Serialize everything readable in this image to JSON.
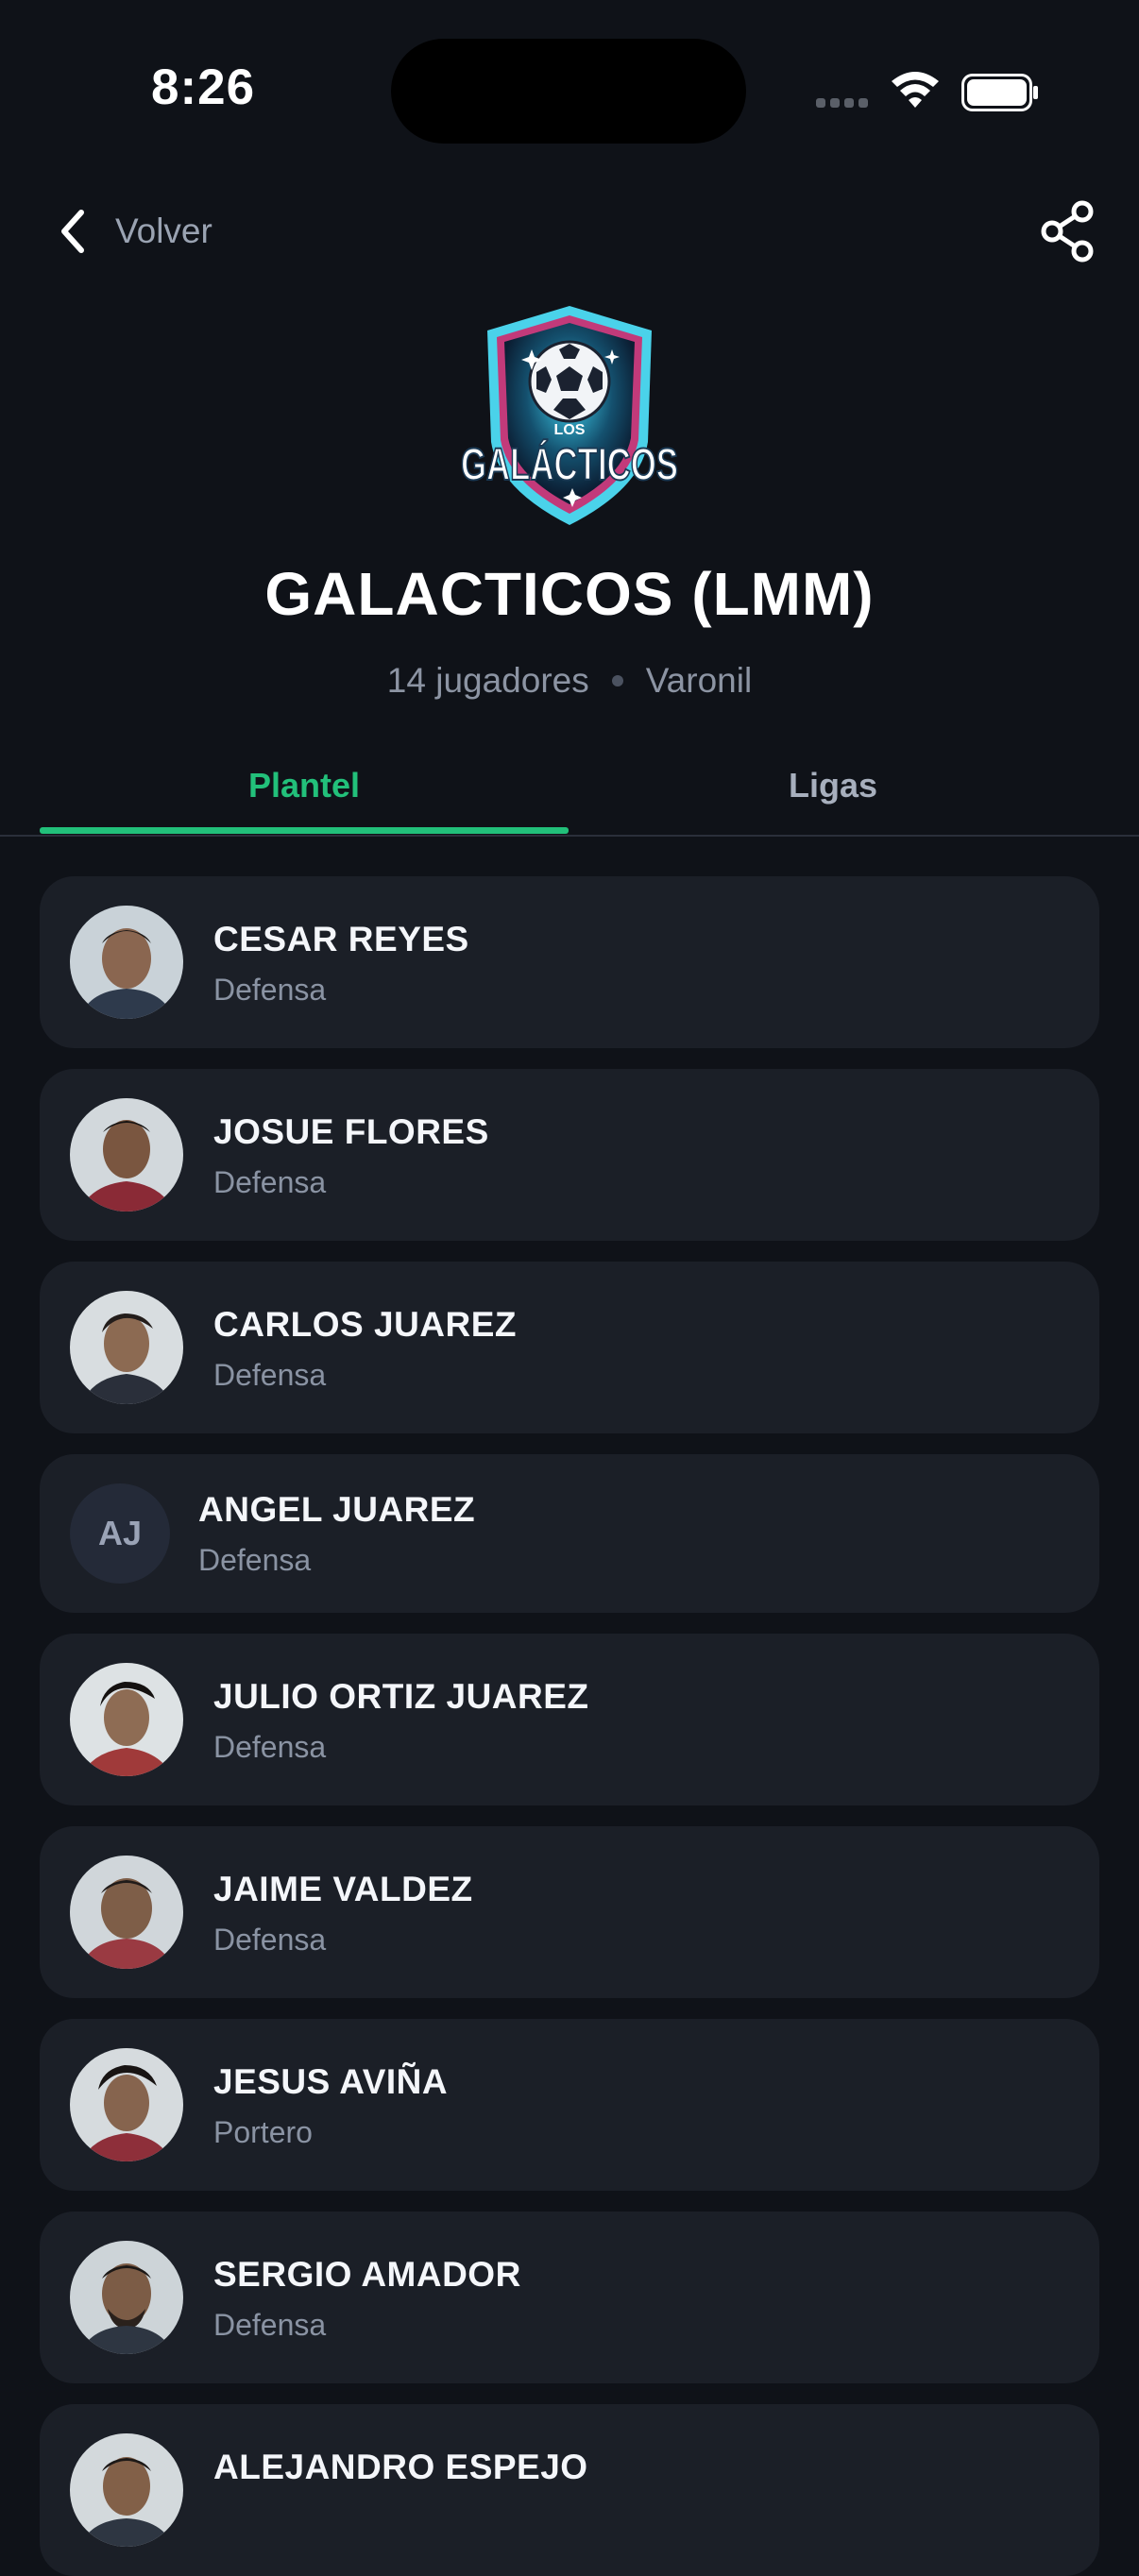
{
  "status_bar": {
    "time": "8:26"
  },
  "nav": {
    "back_label": "Volver",
    "back_icon": "chevron-left-icon",
    "share_icon": "share-icon"
  },
  "team": {
    "crest_top_text": "LOS",
    "crest_main_text": "GALÁCTICOS",
    "name": "GALACTICOS (LMM)",
    "players_count": "14 jugadores",
    "category": "Varonil"
  },
  "tabs": [
    {
      "label": "Plantel",
      "active": true
    },
    {
      "label": "Ligas",
      "active": false
    }
  ],
  "colors": {
    "accent": "#22c07a",
    "background": "#0f1218",
    "card": "#1b1f27"
  },
  "roster": [
    {
      "name": "CESAR REYES",
      "position": "Defensa",
      "avatar": "photo"
    },
    {
      "name": "JOSUE FLORES",
      "position": "Defensa",
      "avatar": "photo"
    },
    {
      "name": "CARLOS JUAREZ",
      "position": "Defensa",
      "avatar": "photo"
    },
    {
      "name": "ANGEL JUAREZ",
      "position": "Defensa",
      "avatar": "initials",
      "initials": "AJ"
    },
    {
      "name": "JULIO ORTIZ JUAREZ",
      "position": "Defensa",
      "avatar": "photo"
    },
    {
      "name": "JAIME VALDEZ",
      "position": "Defensa",
      "avatar": "photo"
    },
    {
      "name": "JESUS AVIÑA",
      "position": "Portero",
      "avatar": "photo"
    },
    {
      "name": "SERGIO AMADOR",
      "position": "Defensa",
      "avatar": "photo"
    },
    {
      "name": "ALEJANDRO ESPEJO",
      "position": "",
      "avatar": "photo"
    }
  ]
}
